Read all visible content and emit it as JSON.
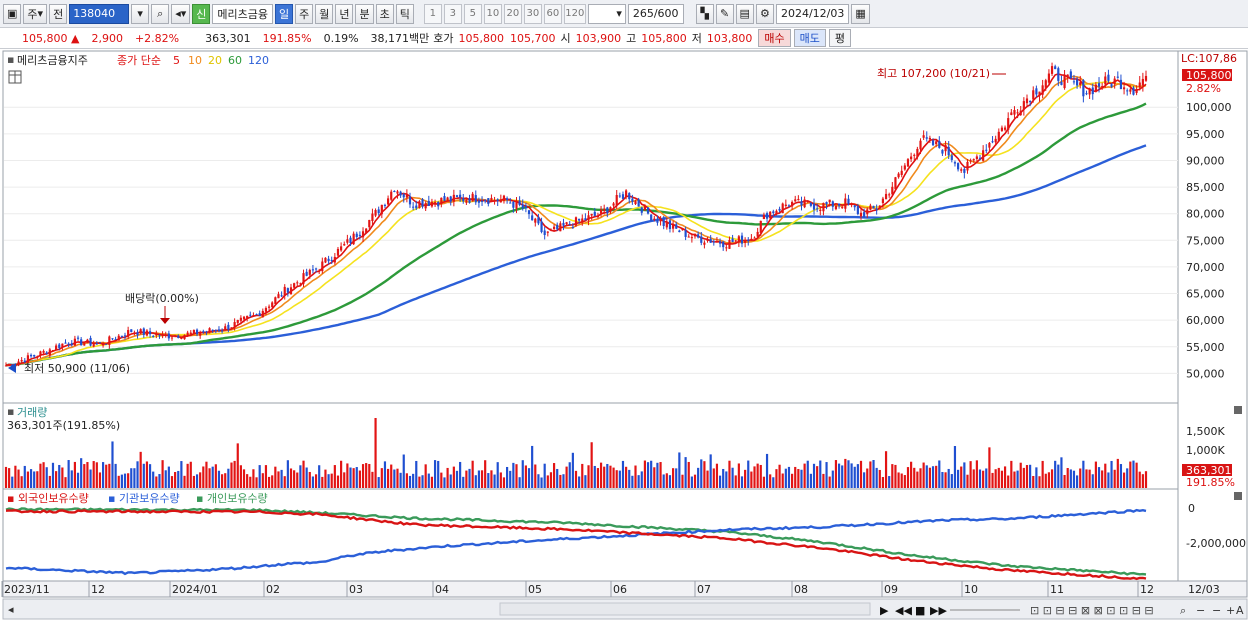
{
  "toolbar": {
    "market": "주",
    "prev": "전",
    "code": "138040",
    "sin": "신",
    "name": "메리츠금융",
    "periods": [
      "일",
      "주",
      "월",
      "년",
      "분",
      "초",
      "틱"
    ],
    "active_period": "일",
    "intervals": [
      "1",
      "3",
      "5",
      "10",
      "20",
      "30",
      "60",
      "120"
    ],
    "count": "265",
    "count_max": "/600",
    "date": "2024/12/03"
  },
  "quote": {
    "price": "105,800",
    "change": "2,900",
    "change_pct": "+2.82%",
    "volume": "363,301",
    "volume_ratio": "191.85%",
    "turnover": "0.19%",
    "amount": "38,171백만",
    "bid_label": "호가",
    "ask": "105,800",
    "bid": "105,700",
    "open_label": "시",
    "open": "103,900",
    "high_label": "고",
    "high": "105,800",
    "low_label": "저",
    "low": "103,800",
    "buy_button": "매수",
    "sell_button": "매도",
    "eval_button": "평"
  },
  "price_panel": {
    "title": "메리츠금융지주",
    "ma_label": "종가 단순",
    "ma_periods": [
      "5",
      "10",
      "20",
      "60",
      "120"
    ],
    "ma_colors": [
      "#e01010",
      "#f08a1c",
      "#f5e21e",
      "#2d9a3a",
      "#2b5fd8"
    ],
    "lc_label": "LC:107,86",
    "price_tag": "105,800",
    "pct_tag": "2.82%",
    "high_note": "최고 107,200 (10/21)",
    "low_note": "최저 50,900 (11/06)",
    "dividend_note": "배당락(0.00%)"
  },
  "volume_panel": {
    "title": "거래량",
    "value_text": "363,301주(191.85%)",
    "axis_labels": [
      "1,500K",
      "1,000K"
    ],
    "tag_value": "363,301",
    "tag_pct": "191.85%"
  },
  "holding_panel": {
    "legend": [
      "외국인보유수량",
      "기관보유수량",
      "개인보유수량"
    ],
    "colors": [
      "#d81414",
      "#2b5fd8",
      "#3a9a5a"
    ],
    "axis_labels": [
      "0",
      "-2,000,000"
    ]
  },
  "xaxis": {
    "labels": [
      "2023/11",
      "12",
      "2024/01",
      "02",
      "03",
      "04",
      "05",
      "06",
      "07",
      "08",
      "09",
      "10",
      "11",
      "12",
      "12/03"
    ]
  },
  "chart_data": {
    "type": "candlestick",
    "yaxis_labels": [
      "100,000",
      "95,000",
      "90,000",
      "85,000",
      "80,000",
      "75,000",
      "70,000",
      "65,000",
      "60,000",
      "55,000",
      "50,000"
    ],
    "ylim": [
      45000,
      110000
    ],
    "price_keypoints": [
      [
        0,
        51500
      ],
      [
        10,
        53500
      ],
      [
        20,
        56000
      ],
      [
        30,
        55500
      ],
      [
        40,
        58000
      ],
      [
        50,
        57000
      ],
      [
        60,
        57500
      ],
      [
        70,
        58500
      ],
      [
        80,
        61000
      ],
      [
        90,
        66000
      ],
      [
        100,
        70000
      ],
      [
        110,
        75000
      ],
      [
        118,
        80000
      ],
      [
        124,
        85000
      ],
      [
        130,
        82000
      ],
      [
        140,
        82500
      ],
      [
        150,
        83000
      ],
      [
        160,
        82500
      ],
      [
        165,
        81000
      ],
      [
        172,
        76000
      ],
      [
        180,
        78000
      ],
      [
        190,
        80000
      ],
      [
        198,
        84000
      ],
      [
        205,
        80000
      ],
      [
        212,
        77500
      ],
      [
        220,
        75500
      ],
      [
        230,
        74500
      ],
      [
        238,
        75500
      ],
      [
        243,
        80000
      ],
      [
        250,
        82000
      ],
      [
        260,
        81500
      ],
      [
        268,
        82000
      ],
      [
        273,
        80000
      ],
      [
        278,
        81000
      ],
      [
        285,
        87000
      ],
      [
        292,
        94000
      ],
      [
        300,
        92000
      ],
      [
        306,
        88000
      ],
      [
        312,
        92000
      ],
      [
        318,
        96000
      ],
      [
        322,
        99500
      ],
      [
        330,
        104000
      ],
      [
        334,
        106500
      ],
      [
        340,
        104500
      ],
      [
        345,
        103000
      ],
      [
        350,
        104500
      ],
      [
        355,
        105000
      ],
      [
        360,
        103500
      ],
      [
        364,
        105800
      ]
    ],
    "holding_keypoints": {
      "foreign": [
        [
          0,
          0.12
        ],
        [
          40,
          0.04
        ],
        [
          60,
          0.08
        ],
        [
          75,
          0.12
        ],
        [
          90,
          0.18
        ],
        [
          100,
          0.2
        ],
        [
          110,
          0.3
        ],
        [
          120,
          0.36
        ],
        [
          140,
          0.44
        ],
        [
          180,
          0.55
        ],
        [
          200,
          0.6
        ],
        [
          230,
          0.68
        ],
        [
          260,
          0.72
        ],
        [
          300,
          0.82
        ],
        [
          320,
          0.84
        ],
        [
          340,
          0.9
        ],
        [
          364,
          0.97
        ]
      ],
      "institution": [
        [
          0,
          0.98
        ],
        [
          80,
          0.97
        ],
        [
          100,
          0.93
        ],
        [
          130,
          0.85
        ],
        [
          180,
          0.78
        ],
        [
          230,
          0.65
        ],
        [
          260,
          0.5
        ],
        [
          290,
          0.3
        ],
        [
          320,
          0.15
        ],
        [
          364,
          0.02
        ]
      ],
      "individual": [
        [
          0,
          0.0
        ],
        [
          40,
          0.05
        ],
        [
          80,
          0.1
        ],
        [
          100,
          0.17
        ],
        [
          130,
          0.2
        ],
        [
          150,
          0.18
        ],
        [
          180,
          0.15
        ],
        [
          210,
          0.12
        ],
        [
          250,
          0.18
        ],
        [
          260,
          0.26
        ],
        [
          265,
          0.5
        ],
        [
          270,
          0.64
        ],
        [
          300,
          0.68
        ],
        [
          330,
          0.82
        ],
        [
          364,
          0.95
        ]
      ]
    }
  }
}
